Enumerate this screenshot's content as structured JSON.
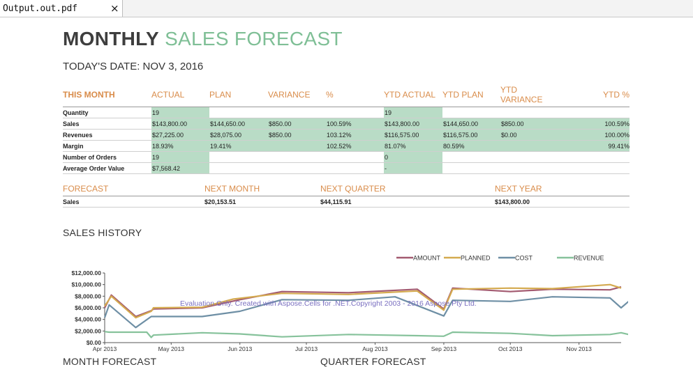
{
  "tab": {
    "title": "Output.out.pdf",
    "close": "×"
  },
  "report": {
    "title_bold": "MONTHLY",
    "title_light": "SALES FORECAST",
    "date": "TODAY'S DATE: NOV 3, 2016",
    "colors": {
      "accent": "#d98c4a",
      "green": "#7fbf96",
      "cell_green": "#b9dcc6"
    },
    "month_table": {
      "headers": [
        "THIS MONTH",
        "ACTUAL",
        "PLAN",
        "VARIANCE",
        "%",
        "YTD ACTUAL",
        "YTD PLAN",
        "YTD VARIANCE",
        "YTD %"
      ],
      "rows": [
        [
          "Quantity",
          "19",
          "",
          "",
          "",
          "19",
          "",
          "",
          ""
        ],
        [
          "Sales",
          "$143,800.00",
          "$144,650.00",
          "$850.00",
          "100.59%",
          "$143,800.00",
          "$144,650.00",
          "$850.00",
          "100.59%"
        ],
        [
          "Revenues",
          "$27,225.00",
          "$28,075.00",
          "$850.00",
          "103.12%",
          "$116,575.00",
          "$116,575.00",
          "$0.00",
          "100.00%"
        ],
        [
          "Margin",
          "18.93%",
          "19.41%",
          "",
          "102.52%",
          "81.07%",
          "80.59%",
          "",
          "99.41%"
        ],
        [
          "Number of Orders",
          "19",
          "",
          "",
          "",
          "0",
          "",
          "",
          ""
        ],
        [
          "Average Order Value",
          "$7,568.42",
          "",
          "",
          "",
          "-",
          "",
          "",
          ""
        ]
      ]
    },
    "forecast_table": {
      "headers": [
        "FORECAST",
        "NEXT MONTH",
        "NEXT QUARTER",
        "NEXT YEAR"
      ],
      "row": [
        "Sales",
        "$20,153.51",
        "$44,115.91",
        "$143,800.00"
      ]
    },
    "sales_history_title": "SALES HISTORY",
    "month_forecast_title": "MONTH FORECAST",
    "quarter_forecast_title": "QUARTER FORECAST"
  },
  "chart_data": {
    "type": "line",
    "title": "SALES HISTORY",
    "legend_placement": "top-right",
    "ylim": [
      0,
      12000
    ],
    "y_ticks": [
      "$0.00",
      "$2,000.00",
      "$4,000.00",
      "$6,000.00",
      "$8,000.00",
      "$10,000.00",
      "$12,000.00"
    ],
    "x_ticks": [
      "Apr 2013",
      "May 2013",
      "Jun 2013",
      "Jul 2013",
      "Aug 2013",
      "Sep 2013",
      "Oct 2013",
      "Nov 2013"
    ],
    "x_range": [
      "2013-04-01",
      "2013-11-20"
    ],
    "grid": false,
    "watermark": "Evaluation Only. Created with Aspose.Cells for .NET.Copyright 2003 - 2016 Aspose Pty Ltd.",
    "series": [
      {
        "name": "AMOUNT",
        "color": "#a35a70",
        "points": [
          [
            "2013-04-01",
            6000
          ],
          [
            "2013-04-04",
            8200
          ],
          [
            "2013-04-15",
            4500
          ],
          [
            "2013-04-22",
            5500
          ],
          [
            "2013-04-23",
            5800
          ],
          [
            "2013-05-15",
            6000
          ],
          [
            "2013-06-01",
            7400
          ],
          [
            "2013-06-20",
            8800
          ],
          [
            "2013-07-20",
            8600
          ],
          [
            "2013-08-20",
            9200
          ],
          [
            "2013-09-01",
            5800
          ],
          [
            "2013-09-05",
            9400
          ],
          [
            "2013-10-01",
            8800
          ],
          [
            "2013-10-20",
            9200
          ],
          [
            "2013-11-15",
            9100
          ],
          [
            "2013-11-20",
            9600
          ]
        ]
      },
      {
        "name": "PLANNED",
        "color": "#d4aa4f",
        "points": [
          [
            "2013-04-01",
            6300
          ],
          [
            "2013-04-04",
            8000
          ],
          [
            "2013-04-15",
            4300
          ],
          [
            "2013-04-22",
            5400
          ],
          [
            "2013-04-23",
            6000
          ],
          [
            "2013-05-15",
            6100
          ],
          [
            "2013-05-29",
            7500
          ],
          [
            "2013-06-20",
            8500
          ],
          [
            "2013-07-20",
            8300
          ],
          [
            "2013-08-20",
            8900
          ],
          [
            "2013-09-01",
            5600
          ],
          [
            "2013-09-05",
            9200
          ],
          [
            "2013-10-01",
            9400
          ],
          [
            "2013-10-20",
            9300
          ],
          [
            "2013-11-15",
            10000
          ],
          [
            "2013-11-20",
            9400
          ]
        ]
      },
      {
        "name": "COST",
        "color": "#6e8fa5",
        "points": [
          [
            "2013-04-01",
            4300
          ],
          [
            "2013-04-03",
            6500
          ],
          [
            "2013-04-15",
            2600
          ],
          [
            "2013-04-22",
            4500
          ],
          [
            "2013-05-15",
            4500
          ],
          [
            "2013-06-01",
            5400
          ],
          [
            "2013-06-20",
            7400
          ],
          [
            "2013-07-20",
            7300
          ],
          [
            "2013-08-10",
            7900
          ],
          [
            "2013-09-01",
            4600
          ],
          [
            "2013-09-05",
            7300
          ],
          [
            "2013-10-01",
            7100
          ],
          [
            "2013-10-20",
            7900
          ],
          [
            "2013-11-15",
            7700
          ],
          [
            "2013-11-20",
            6000
          ],
          [
            "2013-11-28",
            8600
          ]
        ]
      },
      {
        "name": "REVENUE",
        "color": "#86c29b",
        "points": [
          [
            "2013-04-01",
            1900
          ],
          [
            "2013-04-03",
            1800
          ],
          [
            "2013-04-20",
            1800
          ],
          [
            "2013-04-22",
            900
          ],
          [
            "2013-04-23",
            1300
          ],
          [
            "2013-05-15",
            1700
          ],
          [
            "2013-06-01",
            1500
          ],
          [
            "2013-06-20",
            1000
          ],
          [
            "2013-07-20",
            1400
          ],
          [
            "2013-08-20",
            1200
          ],
          [
            "2013-09-01",
            1100
          ],
          [
            "2013-09-05",
            1800
          ],
          [
            "2013-10-01",
            1600
          ],
          [
            "2013-10-20",
            1200
          ],
          [
            "2013-11-15",
            1400
          ],
          [
            "2013-11-20",
            1700
          ],
          [
            "2013-11-28",
            1000
          ]
        ]
      }
    ]
  }
}
